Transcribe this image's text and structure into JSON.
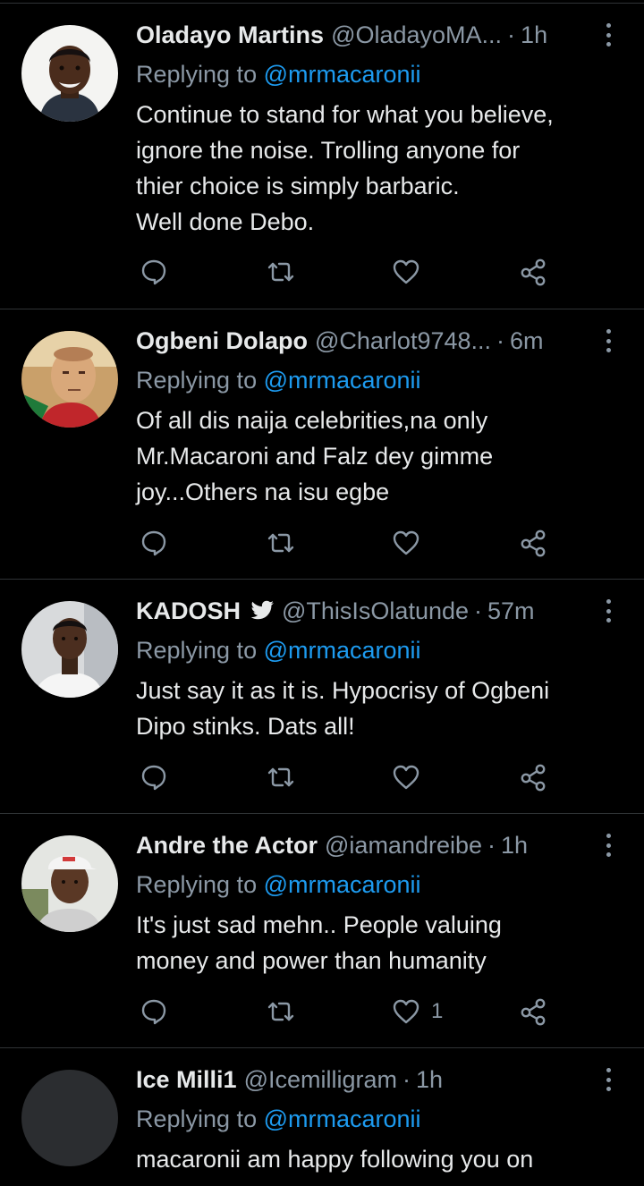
{
  "tweets": [
    {
      "name": "Oladayo Martins",
      "handle": "@OladayoMA...",
      "time": "1h",
      "verified": false,
      "replying_prefix": "Replying to ",
      "replying_to": "@mrmacaronii",
      "body_lines": [
        "Continue to stand for what you believe,",
        "ignore the noise. Trolling anyone for",
        "thier choice is simply barbaric.",
        "Well done Debo."
      ],
      "like_count": ""
    },
    {
      "name": "Ogbeni Dolapo",
      "handle": "@Charlot9748...",
      "time": "6m",
      "verified": false,
      "replying_prefix": "Replying to ",
      "replying_to": "@mrmacaronii",
      "body_lines": [
        "Of all dis naija celebrities,na only",
        "Mr.Macaroni and Falz dey gimme",
        "joy...Others na isu egbe"
      ],
      "like_count": ""
    },
    {
      "name": "KADOSH",
      "handle": "@ThisIsOlatunde",
      "time": "57m",
      "verified": true,
      "replying_prefix": "Replying to ",
      "replying_to": "@mrmacaronii",
      "body_lines": [
        "Just say it as it is. Hypocrisy of Ogbeni",
        "Dipo stinks. Dats all!"
      ],
      "like_count": ""
    },
    {
      "name": "Andre the Actor",
      "handle": "@iamandreibe",
      "time": "1h",
      "verified": false,
      "replying_prefix": "Replying to ",
      "replying_to": "@mrmacaronii",
      "body_lines": [
        "It's just sad mehn..  People valuing",
        "money and power than humanity"
      ],
      "like_count": "1"
    },
    {
      "name": "Ice Milli1",
      "handle": "@Icemilligram",
      "time": "1h",
      "verified": false,
      "replying_prefix": "Replying to ",
      "replying_to": "@mrmacaronii",
      "body_lines": [
        "macaronii am happy following you on"
      ],
      "like_count": ""
    }
  ],
  "separator": "·",
  "icons": {
    "reply": "reply-icon",
    "retweet": "retweet-icon",
    "like": "heart-icon",
    "share": "share-icon",
    "more": "more-vertical-icon",
    "verified": "bird-icon"
  },
  "colors": {
    "background": "#000000",
    "text": "#e7e9ea",
    "secondary": "#8b98a5",
    "link": "#1d9bf0",
    "divider": "#2f3336"
  }
}
